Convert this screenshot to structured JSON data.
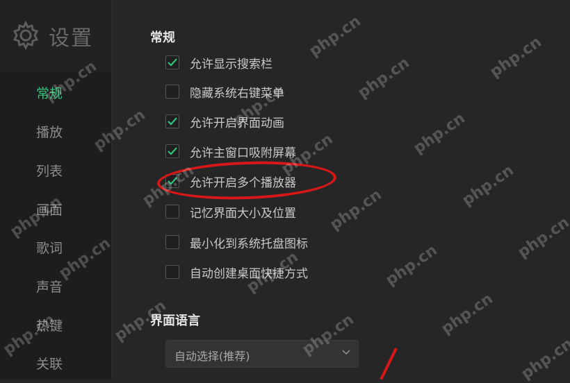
{
  "sidebar": {
    "title": "设置",
    "items": [
      {
        "label": "常规",
        "active": true
      },
      {
        "label": "播放",
        "active": false
      },
      {
        "label": "列表",
        "active": false
      },
      {
        "label": "画面",
        "active": false
      },
      {
        "label": "歌词",
        "active": false
      },
      {
        "label": "声音",
        "active": false
      },
      {
        "label": "热键",
        "active": false
      },
      {
        "label": "关联",
        "active": false
      }
    ]
  },
  "general": {
    "title": "常规",
    "options": [
      {
        "label": "允许显示搜索栏",
        "checked": true
      },
      {
        "label": "隐藏系统右键菜单",
        "checked": false
      },
      {
        "label": "允许开启界面动画",
        "checked": true
      },
      {
        "label": "允许主窗口吸附屏幕",
        "checked": true
      },
      {
        "label": "允许开启多个播放器",
        "checked": true
      },
      {
        "label": "记忆界面大小及位置",
        "checked": false
      },
      {
        "label": "最小化到系统托盘图标",
        "checked": false
      },
      {
        "label": "自动创建桌面快捷方式",
        "checked": false
      }
    ]
  },
  "language": {
    "title": "界面语言",
    "selected": "自动选择(推荐)"
  },
  "watermark": {
    "text": "php.cn"
  },
  "colors": {
    "accent": "#31c27c",
    "highlight": "#d81818",
    "background": "#262626"
  }
}
